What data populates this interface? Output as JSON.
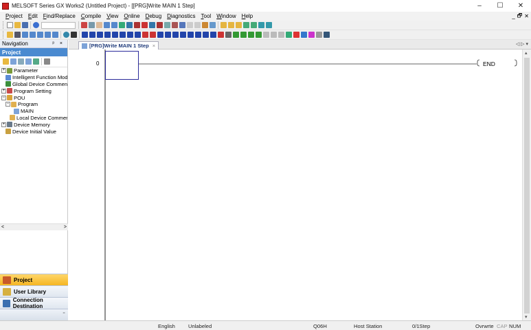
{
  "window": {
    "title": "MELSOFT Series GX Works2 (Untitled Project) - [[PRG]Write MAIN 1 Step]",
    "minimize": "–",
    "maximize": "☐",
    "close": "✕"
  },
  "menu": {
    "items": [
      "Project",
      "Edit",
      "Find/Replace",
      "Compile",
      "View",
      "Online",
      "Debug",
      "Diagnostics",
      "Tool",
      "Window",
      "Help"
    ],
    "mdi_min": "_",
    "mdi_restore": "🗗",
    "mdi_close": "✕"
  },
  "navigation": {
    "title": "Navigation",
    "pin": "ᵖ ×",
    "section": "Project",
    "tree": [
      {
        "label": "Parameter",
        "depth": 0,
        "expander": "+",
        "icon": "#7a9a3a"
      },
      {
        "label": "Intelligent Function Modu",
        "depth": 1,
        "expander": "",
        "icon": "#5a8ad6"
      },
      {
        "label": "Global Device Comment",
        "depth": 1,
        "expander": "",
        "icon": "#3c8f3c"
      },
      {
        "label": "Program Setting",
        "depth": 0,
        "expander": "+",
        "icon": "#c84a4a"
      },
      {
        "label": "POU",
        "depth": 0,
        "expander": "−",
        "icon": "#d8a43a"
      },
      {
        "label": "Program",
        "depth": 1,
        "expander": "−",
        "icon": "#e0b050"
      },
      {
        "label": "MAIN",
        "depth": 3,
        "expander": "",
        "icon": "#7da3d8"
      },
      {
        "label": "Local Device Commer",
        "depth": 2,
        "expander": "",
        "icon": "#e0b050"
      },
      {
        "label": "Device Memory",
        "depth": 0,
        "expander": "+",
        "icon": "#6a7a8a"
      },
      {
        "label": "Device Initial Value",
        "depth": 1,
        "expander": "",
        "icon": "#c8a040"
      }
    ],
    "scroll_left": "<",
    "scroll_right": ">",
    "buttons": {
      "project": "Project",
      "user_library": "User Library",
      "connection": "Connection Destination"
    }
  },
  "editor": {
    "tab_label": "[PRG]Write MAIN 1 Step",
    "tab_close": "×",
    "tab_nav": "◁ ▷ ▾",
    "step_number": "0",
    "end_instruction": "END"
  },
  "status": {
    "language": "English",
    "label": "Unlabeled",
    "cpu": "Q06H",
    "station": "Host Station",
    "steps": "0/1Step",
    "mode": "Ovrwrte",
    "caps": "CAP",
    "num": "NUM"
  }
}
